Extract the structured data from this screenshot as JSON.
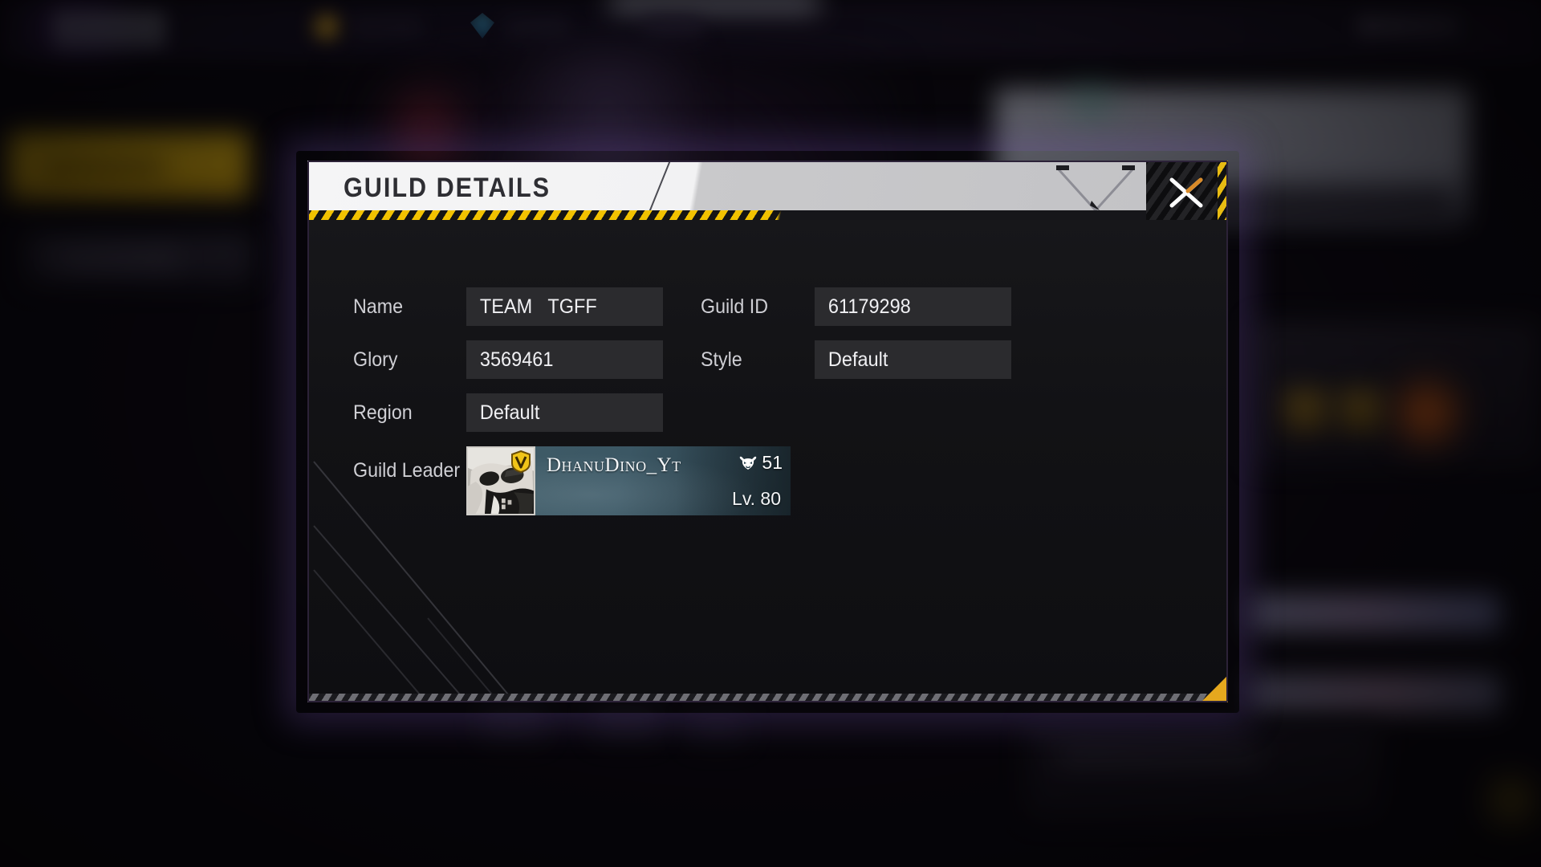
{
  "dialog": {
    "title": "GUILD DETAILS",
    "close_label": "Close",
    "close_icon": "close-x-icon"
  },
  "fields": {
    "name": {
      "label": "Name",
      "value": "TEAM   TGFF"
    },
    "glory": {
      "label": "Glory",
      "value": "3569461"
    },
    "region": {
      "label": "Region",
      "value": "Default"
    },
    "guild_id": {
      "label": "Guild ID",
      "value": "61179298"
    },
    "style": {
      "label": "Style",
      "value": "Default"
    }
  },
  "guild_leader": {
    "label": "Guild Leader",
    "name": "DhanuDino_Yt",
    "rank_icon": "oni-mask-icon",
    "rank_value": "51",
    "level": "Lv. 80",
    "badge_icon": "v-badge-icon",
    "avatar_icon": "skull-avatar"
  },
  "colors": {
    "hazard_yellow": "#f2c200",
    "accent_gold": "#e5a81e",
    "titlebar_light": "#f5f5f6",
    "titlebar_gray": "#c3c3c6",
    "field_box": "#2b2b2e",
    "panel_bg": "#121215",
    "leader_banner": "#3b5764"
  }
}
